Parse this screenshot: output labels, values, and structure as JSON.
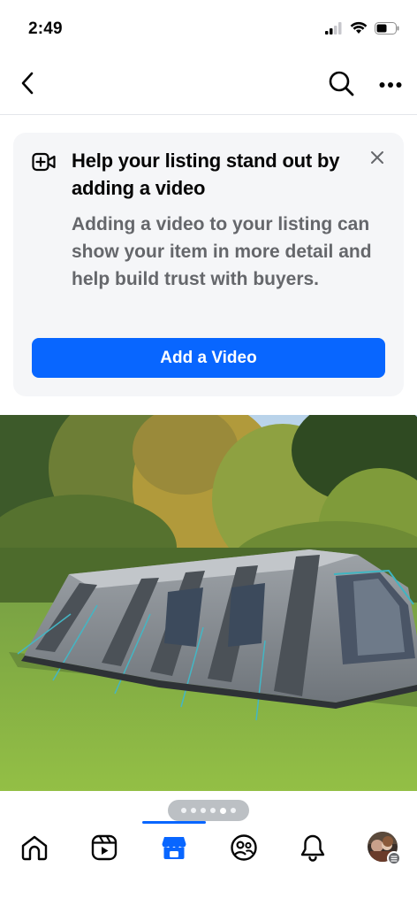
{
  "status_bar": {
    "time": "2:49",
    "icons": [
      "cellular-signal-icon",
      "wifi-icon",
      "battery-icon"
    ]
  },
  "nav": {
    "icons": [
      "back-chevron-icon",
      "search-icon",
      "more-dots-icon"
    ]
  },
  "video_prompt": {
    "icon": "video-add-icon",
    "title": "Help your listing stand out by adding a video",
    "body": "Adding a video to your listing can show your item in more detail and help build trust with buyers.",
    "button_label": "Add a Video",
    "close_icon": "close-icon"
  },
  "photo_carousel": {
    "dot_count": 6,
    "active_dot": 5
  },
  "tab_bar": {
    "tabs": [
      {
        "icon": "home-icon",
        "active": false
      },
      {
        "icon": "video-icon",
        "active": false
      },
      {
        "icon": "marketplace-icon",
        "active": true
      },
      {
        "icon": "friends-icon",
        "active": false
      },
      {
        "icon": "notifications-icon",
        "active": false
      },
      {
        "icon": "profile-avatar",
        "active": false
      }
    ]
  },
  "colors": {
    "accent": "#0866ff",
    "secondary_text": "#65676b",
    "card_background": "#f5f6f8"
  }
}
